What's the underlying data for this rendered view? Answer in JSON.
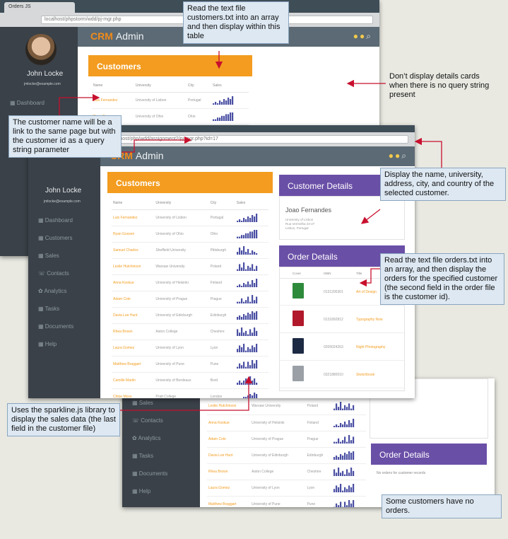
{
  "browser": {
    "tab_title": "Orders JS",
    "address_back": "localhost/phpstorm/wdd/pj-mgr.php",
    "address_front": "localhost/php/wdd/assignment2/pj-mgr.php?id=17"
  },
  "app": {
    "brand": "CRM",
    "title": "Admin"
  },
  "user": {
    "name": "John Locke",
    "email": "jmlocke@example.com"
  },
  "nav": [
    "Dashboard",
    "Customers",
    "Sales",
    "Contacts",
    "Analytics",
    "Tasks",
    "Documents",
    "Help"
  ],
  "customers": {
    "title": "Customers",
    "columns": [
      "Name",
      "University",
      "City",
      "Sales"
    ],
    "rows": [
      {
        "name": "Luis Fernandez",
        "university": "University of Lisbon",
        "city": "Portugal",
        "sales": [
          1,
          2,
          1,
          3,
          2,
          4,
          3,
          5,
          4,
          6
        ]
      },
      {
        "name": "Ryan Gossen",
        "university": "University of Ohio",
        "city": "Ohio",
        "sales": [
          1,
          1,
          2,
          2,
          3,
          3,
          4,
          4,
          5,
          5
        ]
      },
      {
        "name": "Samuel Charles",
        "university": "Sheffield University",
        "city": "Pittsburgh",
        "sales": [
          2,
          5,
          3,
          6,
          2,
          4,
          1,
          3,
          2,
          1
        ]
      },
      {
        "name": "Leslie Hutchinson",
        "university": "Warsaw University",
        "city": "Poland",
        "sales": [
          1,
          4,
          2,
          5,
          1,
          3,
          2,
          4,
          1,
          3
        ]
      },
      {
        "name": "Anna Koskue",
        "university": "University of Helsinki",
        "city": "Finland",
        "sales": [
          1,
          2,
          1,
          3,
          2,
          4,
          2,
          5,
          3,
          6
        ]
      },
      {
        "name": "Adam Cole",
        "university": "University of Prague",
        "city": "Prague",
        "sales": [
          1,
          1,
          3,
          1,
          2,
          4,
          1,
          5,
          2,
          4
        ]
      },
      {
        "name": "Davia Lee Hunt",
        "university": "University of Edinburgh",
        "city": "Edinburgh",
        "sales": [
          2,
          3,
          2,
          4,
          3,
          5,
          4,
          6,
          5,
          6
        ]
      },
      {
        "name": "Rhea Brown",
        "university": "Aston College",
        "city": "Cheshire",
        "sales": [
          4,
          2,
          5,
          2,
          3,
          1,
          4,
          2,
          5,
          3
        ]
      },
      {
        "name": "Laura Gomez",
        "university": "University of Lyon",
        "city": "Lyon",
        "sales": [
          2,
          4,
          3,
          5,
          1,
          3,
          2,
          4,
          3,
          5
        ]
      },
      {
        "name": "Matthew Braggart",
        "university": "University of Pune",
        "city": "Pune",
        "sales": [
          1,
          3,
          2,
          4,
          1,
          4,
          2,
          5,
          3,
          5
        ]
      },
      {
        "name": "Camille Martin",
        "university": "University of Bordeaux",
        "city": "Bord",
        "sales": [
          1,
          2,
          1,
          2,
          3,
          1,
          4,
          2,
          3,
          1
        ]
      },
      {
        "name": "Chloe Moss",
        "university": "Pratt College",
        "city": "London",
        "sales": [
          1,
          2,
          2,
          3,
          3,
          4,
          5,
          4,
          6,
          5
        ]
      }
    ]
  },
  "customer_details": {
    "title": "Customer Details",
    "name": "Joao Fernandes",
    "lines": [
      "University of Lisbon",
      "Rua Vermelha 23-27",
      "Lisbon, Portugal"
    ]
  },
  "order_details": {
    "title": "Order Details",
    "columns": [
      "Cover",
      "ISBN",
      "Title"
    ],
    "rows": [
      {
        "isbn": "0131200301",
        "title": "Art of Design",
        "color": "#2e8b3c"
      },
      {
        "isbn": "0131892812",
        "title": "Typography Now",
        "color": "#b2182b"
      },
      {
        "isbn": "0205024263",
        "title": "Night Photography",
        "color": "#1d2a44"
      },
      {
        "isbn": "0321880010",
        "title": "Sketchbook",
        "color": "#9aa0a6"
      }
    ],
    "empty_text": "No orders for customer records"
  },
  "callouts": {
    "read_customers": "Read the text file customers.txt into an array and then display within this table",
    "no_query": "Don’t display details cards when there is no query string present",
    "link": "The customer name will be a link to the same page but with the customer id as a query string parameter",
    "display_name": "Display the name, university, address, city, and country of the selected customer.",
    "read_orders": "Read the text file orders.txt into an array, and then display the orders for the specified customer (the second field in the order file is the customer id).",
    "sparkline": "Uses the sparkline.js library to display the sales data (the last field in the customer file)",
    "no_orders": "Some customers have no orders."
  },
  "colors": {
    "accent": "#f39c1f",
    "purple": "#6a4fa7",
    "sidebar": "#3a4148",
    "header": "#5b6a74",
    "arrow": "#c8102e"
  }
}
